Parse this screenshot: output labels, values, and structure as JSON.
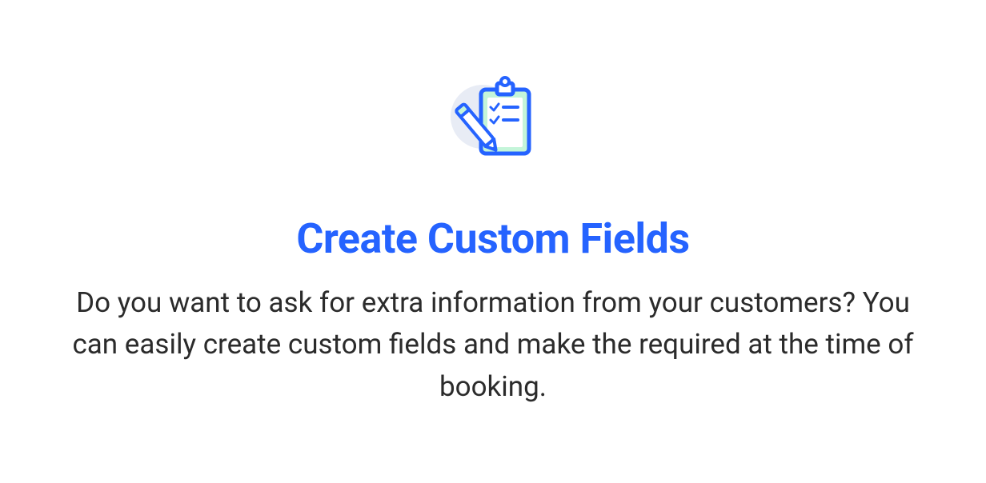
{
  "heading": "Create Custom Fields",
  "description": "Do you want to ask for extra information from your customers? You can easily create custom fields and make the required at the time of booking.",
  "colors": {
    "primary": "#2563ff",
    "text": "#2b2b2b",
    "iconFill": "#c4f5d9",
    "iconBg": "#e8ecf5"
  }
}
